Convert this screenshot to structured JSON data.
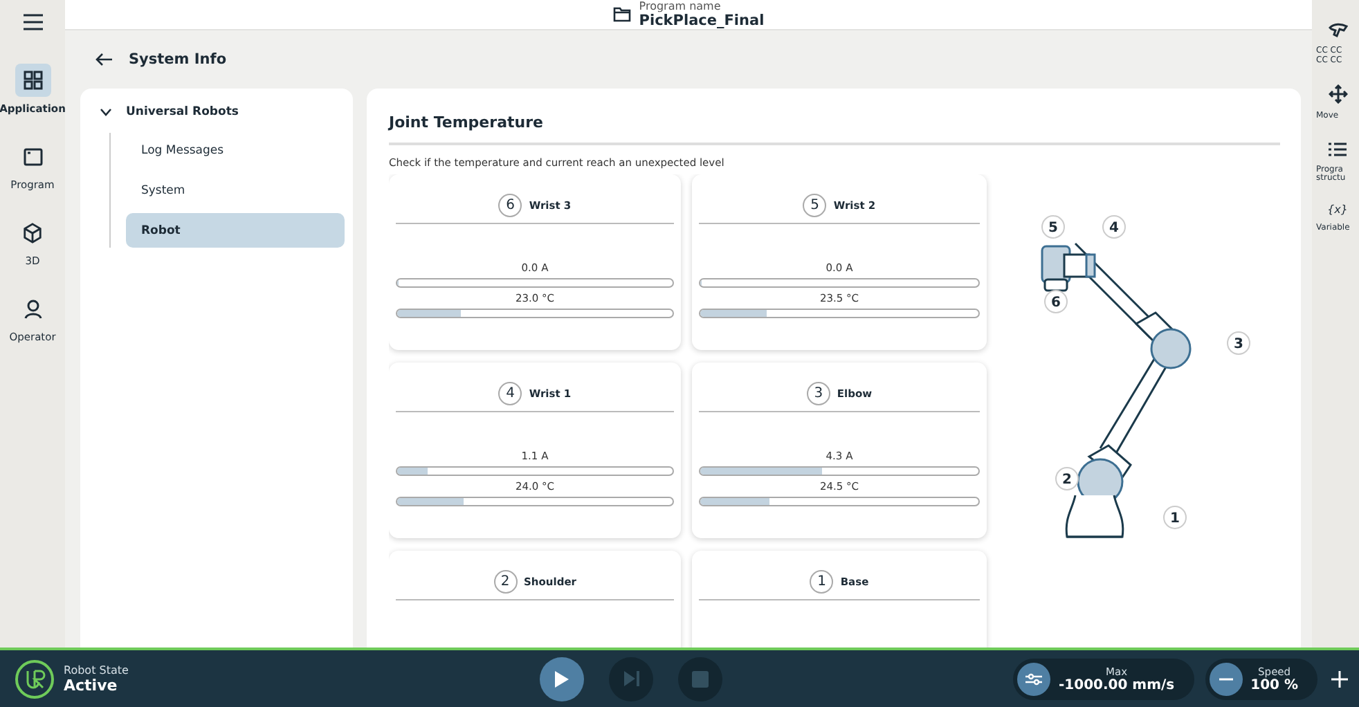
{
  "nav_rail": [
    {
      "label": "Application",
      "selected": true
    },
    {
      "label": "Program",
      "selected": false
    },
    {
      "label": "3D",
      "selected": false
    },
    {
      "label": "Operator",
      "selected": false
    }
  ],
  "header": {
    "caption": "Program name",
    "program": "PickPlace_Final"
  },
  "page_title": "System Info",
  "tree": {
    "label": "Universal Robots",
    "expanded": true,
    "children": [
      {
        "label": "Log Messages",
        "selected": false
      },
      {
        "label": "System",
        "selected": false
      },
      {
        "label": "Robot",
        "selected": true
      }
    ]
  },
  "panel": {
    "title": "Joint Temperature",
    "description": "Check if the temperature and current reach an unexpected level"
  },
  "joints": [
    {
      "number": "6",
      "name": "Wrist 3",
      "current": "0.0 A",
      "current_level": {
        "level": 0
      },
      "temperature": "23.0 °C",
      "temperature_level": {
        "level": 0.23
      }
    },
    {
      "number": "5",
      "name": "Wrist 2",
      "current": "0.0 A",
      "current_level": {
        "level": 0
      },
      "temperature": "23.5 °C",
      "temperature_level": {
        "level": 0.24
      }
    },
    {
      "number": "4",
      "name": "Wrist 1",
      "current": "1.1 A",
      "current_level": {
        "level": 0.11
      },
      "temperature": "24.0 °C",
      "temperature_level": {
        "level": 0.24
      }
    },
    {
      "number": "3",
      "name": "Elbow",
      "current": "4.3 A",
      "current_level": {
        "level": 0.44
      },
      "temperature": "24.5 °C",
      "temperature_level": {
        "level": 0.25
      }
    },
    {
      "number": "2",
      "name": "Shoulder"
    },
    {
      "number": "1",
      "name": "Base"
    }
  ],
  "robot_labels": [
    "5",
    "4",
    "6",
    "3",
    "2",
    "1"
  ],
  "side_tools": [
    {
      "lines": [
        "CC CC",
        "CC CC"
      ]
    },
    {
      "lines": [
        "Move"
      ]
    },
    {
      "lines": [
        "Progra",
        "structu"
      ]
    },
    {
      "lines": [
        "Variable"
      ],
      "symbol": "{x}"
    }
  ],
  "status_bar": {
    "caption": "Robot State",
    "state": "Active",
    "controls": [
      {
        "disabled": false
      },
      {
        "disabled": true
      },
      {
        "disabled": true
      }
    ],
    "max": {
      "caption": "Max",
      "value": "-1000.00 mm/s"
    },
    "speed": {
      "caption": "Speed",
      "value": "100 %"
    }
  }
}
